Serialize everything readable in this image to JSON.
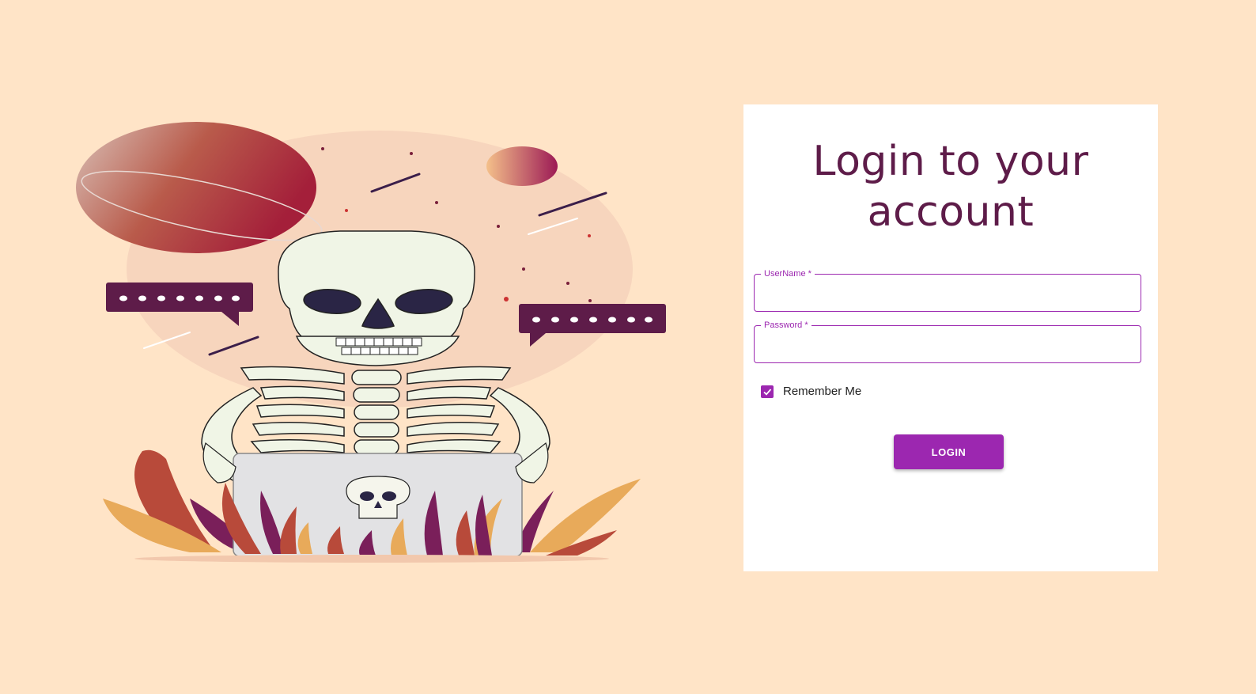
{
  "login": {
    "title_line1": "Login to your",
    "title_line2": "account",
    "username_label": "UserName *",
    "username_value": "",
    "password_label": "Password *",
    "password_value": "",
    "remember_label": "Remember Me",
    "remember_checked": true,
    "login_button": "LOGIN"
  },
  "illustration": {
    "subject": "skeleton-with-laptop",
    "speech_bubble_dots": "• • • • • • •"
  },
  "colors": {
    "background": "#ffe4c7",
    "accent": "#9c27b0",
    "title": "#5e1c49",
    "bubble": "#5e1c49"
  }
}
